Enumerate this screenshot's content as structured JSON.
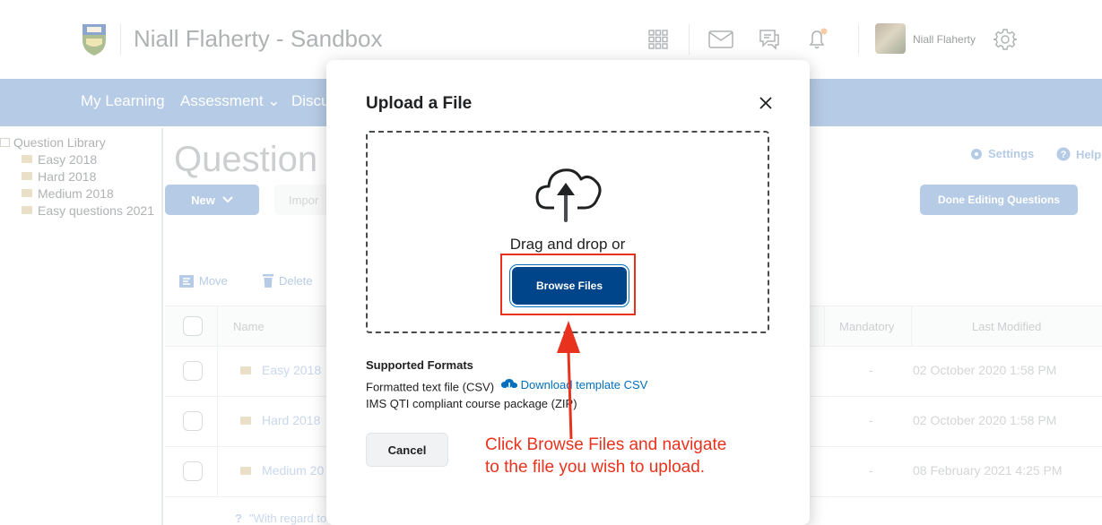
{
  "header": {
    "org_title": "Niall Flaherty - Sandbox",
    "user_name": "Niall Flaherty"
  },
  "nav": {
    "items": [
      "My Learning",
      "Assessment ⌄",
      "Discu"
    ]
  },
  "tree": {
    "root": "Question Library",
    "folders": [
      "Easy 2018",
      "Hard 2018",
      "Medium 2018",
      "Easy questions 2021"
    ]
  },
  "main": {
    "title": "Question L",
    "new_label": "New",
    "import_label": "Impor",
    "settings_label": "Settings",
    "help_label": "Help",
    "done_label": "Done Editing Questions",
    "move_label": "Move",
    "delete_label": "Delete",
    "columns": {
      "name": "Name",
      "mandatory": "Mandatory",
      "last_modified": "Last Modified"
    },
    "rows": [
      {
        "name": "Easy 2018",
        "mandatory": "-",
        "modified": "02 October 2020 1:58 PM"
      },
      {
        "name": "Hard 2018",
        "mandatory": "-",
        "modified": "02 October 2020 1:58 PM"
      },
      {
        "name": "Medium 20",
        "mandatory": "-",
        "modified": "08 February 2021 4:25 PM"
      }
    ],
    "partial_row": "\"With regard to corporate goals, an MVP is mostly"
  },
  "dialog": {
    "title": "Upload a File",
    "drop_text": "Drag and drop or",
    "browse_label": "Browse Files",
    "formats_title": "Supported Formats",
    "format_csv": "Formatted text file (CSV)",
    "download_label": "Download template CSV",
    "format_zip": "IMS QTI compliant course package (ZIP)",
    "cancel_label": "Cancel"
  },
  "annotation": {
    "line1": "Click Browse Files and navigate",
    "line2": "to the file you wish to upload."
  },
  "colors": {
    "nav": "#7ba0cf",
    "primary_button": "#004489",
    "link": "#006fbf",
    "annotation": "#e8321e"
  }
}
